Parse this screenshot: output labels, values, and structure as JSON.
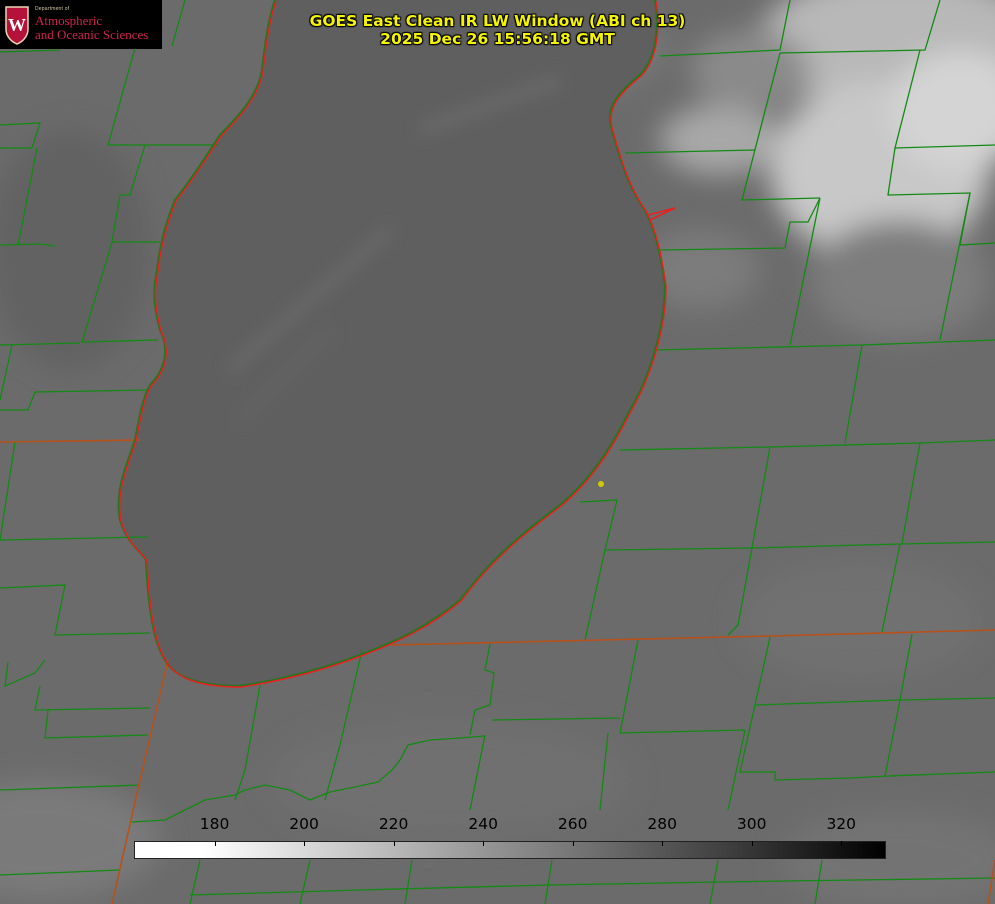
{
  "title": {
    "line1": "GOES East Clean IR LW Window (ABI ch 13)",
    "line2": "2025 Dec 26 15:56:18 GMT"
  },
  "logo": {
    "dept": "Department of",
    "line1": "Atmospheric",
    "line2": "and Oceanic Sciences",
    "crest_letter": "W",
    "crest_color": "#b5123a"
  },
  "colorbar": {
    "min": 162,
    "max": 330,
    "ticks": [
      "180",
      "200",
      "220",
      "240",
      "260",
      "280",
      "300",
      "320"
    ],
    "tick_values": [
      180,
      200,
      220,
      240,
      260,
      280,
      300,
      320
    ]
  },
  "colors": {
    "lake_outline": "#e82020",
    "county_lines": "#138a13",
    "state_lines": "#b8501a",
    "title_text": "#f4f400",
    "station_marker": "#d4c800"
  }
}
